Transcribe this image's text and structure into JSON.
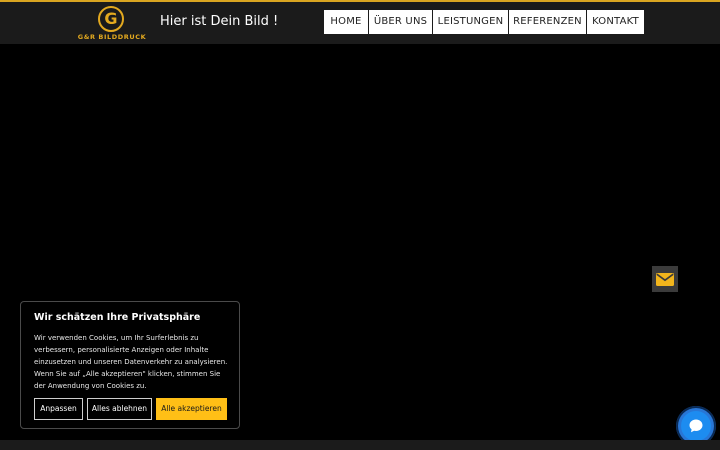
{
  "header": {
    "logo_letter": "G",
    "logo_text": "G&R BILDDRUCK",
    "tagline": "Hier ist Dein Bild !",
    "accent_color": "#d9a521"
  },
  "nav": {
    "items": [
      {
        "label": "HOME"
      },
      {
        "label": "ÜBER UNS"
      },
      {
        "label": "LEISTUNGEN"
      },
      {
        "label": "REFERENZEN"
      },
      {
        "label": "KONTAKT"
      }
    ]
  },
  "floating": {
    "mail_icon": "envelope-icon",
    "chat_icon": "chat-bubble-icon",
    "chat_color": "#2876d6"
  },
  "cookie_banner": {
    "title": "Wir schätzen Ihre Privatsphäre",
    "text": "Wir verwenden Cookies, um Ihr Surferlebnis zu verbessern, personalisierte Anzeigen oder Inhalte einzusetzen und unseren Datenverkehr zu analysieren. Wenn Sie auf „Alle akzeptieren\" klicken, stimmen Sie der Anwendung von Cookies zu.",
    "buttons": {
      "customize": "Anpassen",
      "reject": "Alles ablehnen",
      "accept": "Alle akzeptieren"
    },
    "accept_color": "#ffbf16"
  }
}
